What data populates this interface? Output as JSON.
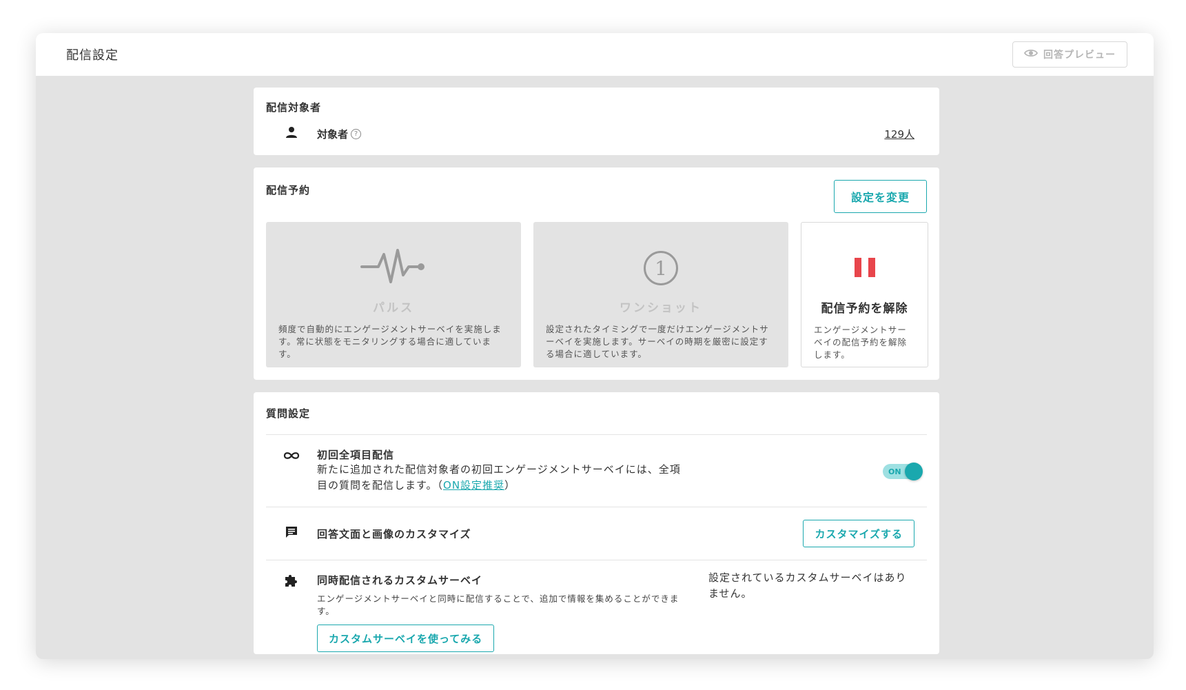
{
  "header": {
    "title": "配信設定",
    "preview_label": "回答プレビュー"
  },
  "target": {
    "section_title": "配信対象者",
    "label": "対象者",
    "help": "?",
    "count": "129人"
  },
  "schedule": {
    "section_title": "配信予約",
    "change_button": "設定を変更",
    "options": [
      {
        "name": "パルス",
        "description": "頻度で自動的にエンゲージメントサーベイを実施します。常に状態をモニタリングする場合に適しています。"
      },
      {
        "name": "ワンショット",
        "icon_text": "1",
        "description": "設定されたタイミングで一度だけエンゲージメントサーベイを実施します。サーベイの時期を厳密に設定する場合に適しています。"
      },
      {
        "name": "配信予約を解除",
        "description": "エンゲージメントサーベイの配信予約を解除します。"
      }
    ],
    "pause_color": "#e8454b"
  },
  "questions": {
    "section_title": "質問設定",
    "initial": {
      "title": "初回全項目配信",
      "text_line1": "新たに追加された配信対象者の初回エンゲージメントサーベイには、全項",
      "text_line2": "目の質問を配信します。（",
      "link": "ON設定推奨",
      "text_end": "）",
      "toggle_label": "ON"
    },
    "customize": {
      "title": "回答文面と画像のカスタマイズ",
      "button": "カスタマイズする"
    },
    "custom_survey": {
      "title": "同時配信されるカスタムサーベイ",
      "description": "エンゲージメントサーベイと同時に配信することで、追加で情報を集めることができます。",
      "button": "カスタムサーベイを使ってみる",
      "status": "設定されているカスタムサーベイはありません。"
    }
  },
  "colors": {
    "accent": "#1aa8ae",
    "background": "#e3e3e3"
  }
}
